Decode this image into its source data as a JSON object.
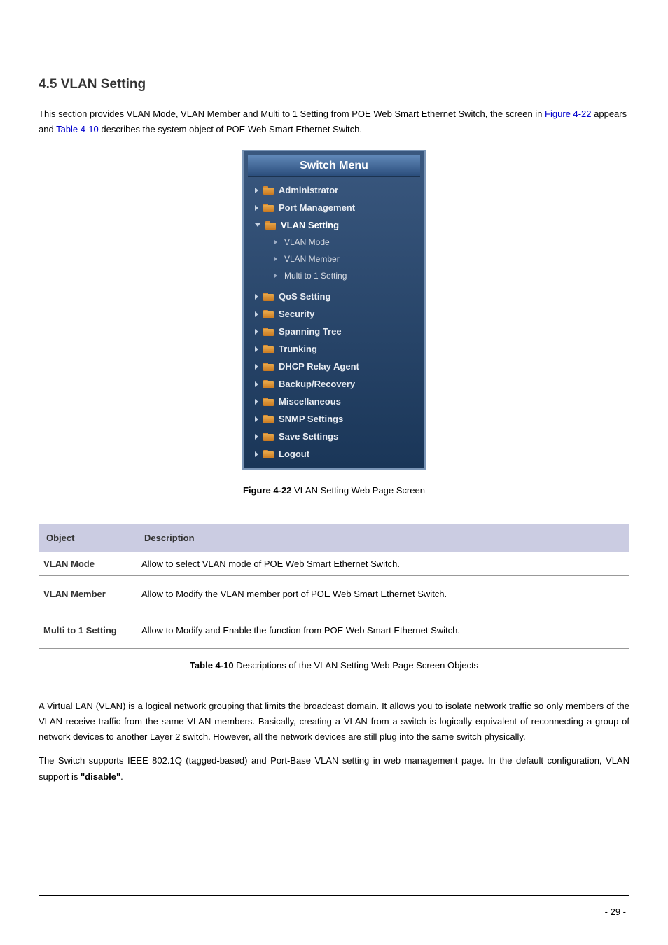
{
  "section_heading": "4.5 VLAN Setting",
  "intro": {
    "part1": "This section provides VLAN Mode, VLAN Member and Multi to 1 Setting from POE Web Smart Ethernet Switch, the screen in ",
    "fig_ref": "Figure 4-22",
    "part2": " appears and ",
    "tbl_ref": "Table 4-10",
    "part3": " describes the system object of POE Web Smart Ethernet Switch."
  },
  "menu": {
    "header": "Switch Menu",
    "items": [
      {
        "label": "Administrator",
        "expanded": false
      },
      {
        "label": "Port Management",
        "expanded": false
      },
      {
        "label": "VLAN Setting",
        "expanded": true
      },
      {
        "label": "QoS Setting",
        "expanded": false
      },
      {
        "label": "Security",
        "expanded": false
      },
      {
        "label": "Spanning Tree",
        "expanded": false
      },
      {
        "label": "Trunking",
        "expanded": false
      },
      {
        "label": "DHCP Relay Agent",
        "expanded": false
      },
      {
        "label": "Backup/Recovery",
        "expanded": false
      },
      {
        "label": "Miscellaneous",
        "expanded": false
      },
      {
        "label": "SNMP Settings",
        "expanded": false
      },
      {
        "label": "Save Settings",
        "expanded": false
      },
      {
        "label": "Logout",
        "expanded": false
      }
    ],
    "sub_items": [
      {
        "label": "VLAN Mode"
      },
      {
        "label": "VLAN Member"
      },
      {
        "label": "Multi to 1 Setting"
      }
    ]
  },
  "figure_caption": {
    "bold": "Figure 4-22",
    "rest": " VLAN Setting Web Page Screen"
  },
  "table": {
    "headers": [
      "Object",
      "Description"
    ],
    "rows": [
      {
        "obj": "VLAN Mode",
        "desc": "Allow to select VLAN mode of POE Web Smart Ethernet Switch.",
        "multi": false
      },
      {
        "obj": "VLAN Member",
        "desc": "Allow to Modify the VLAN member port of POE Web Smart Ethernet Switch.",
        "multi": true
      },
      {
        "obj": "Multi to 1 Setting",
        "desc": "Allow to Modify and Enable the function from POE Web Smart Ethernet Switch.",
        "multi": true
      }
    ]
  },
  "table_caption": {
    "bold": "Table 4-10",
    "rest": " Descriptions of the VLAN Setting Web Page Screen Objects"
  },
  "para1": "A Virtual LAN (VLAN) is a logical network grouping that limits the broadcast domain. It allows you to isolate network traffic so only members of the VLAN receive traffic from the same VLAN members. Basically, creating a VLAN from a switch is logically equivalent of reconnecting a group of network devices to another Layer 2 switch. However, all the network devices are still plug into the same switch physically.",
  "para2": {
    "part1": "The Switch supports IEEE 802.1Q (tagged-based) and Port-Base VLAN setting in web management page. In the default configuration, VLAN support is ",
    "bold": "\"disable\"",
    "part2": "."
  },
  "page_number": "- 29 -"
}
